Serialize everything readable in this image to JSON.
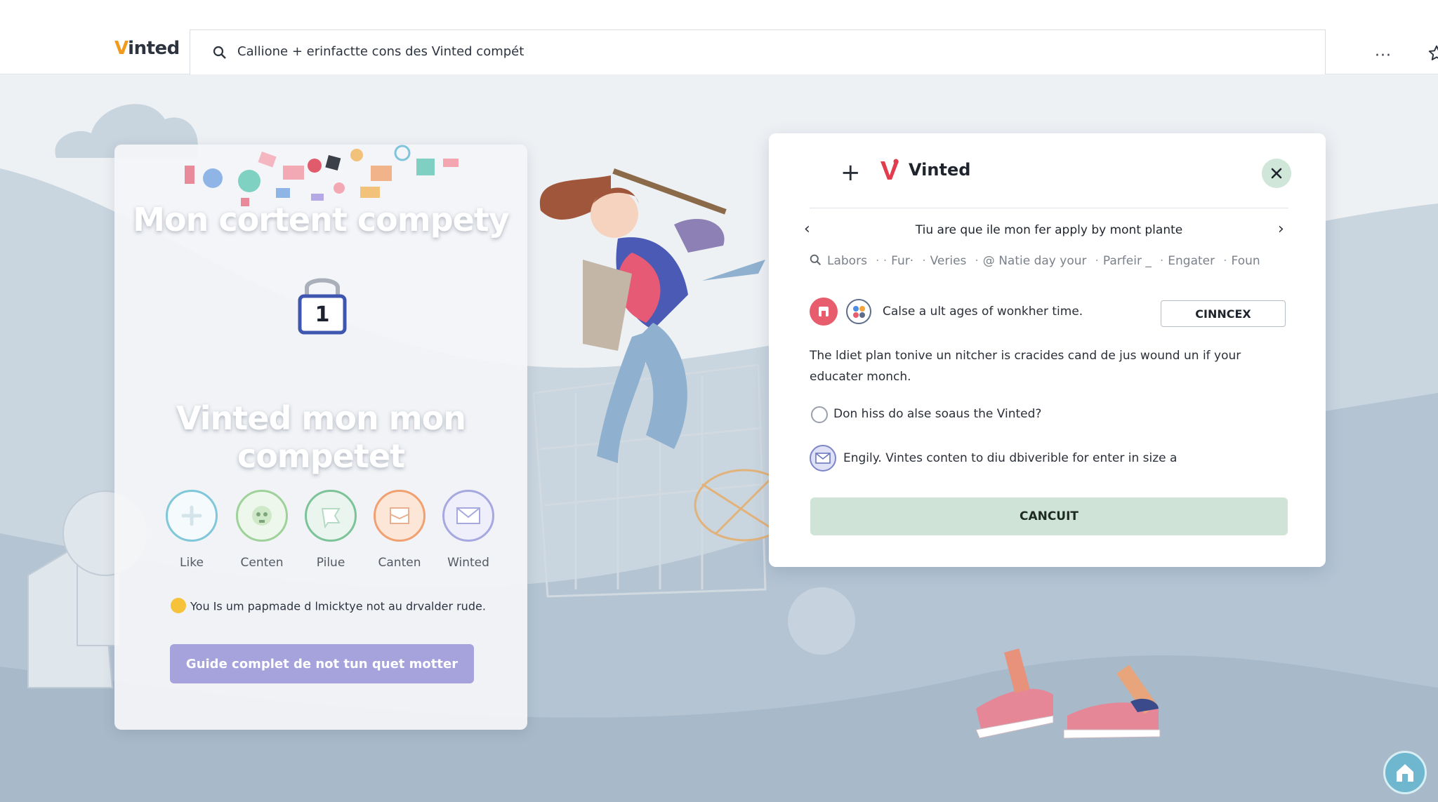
{
  "app": {
    "logo_v": "V",
    "logo_rest": "inted"
  },
  "search": {
    "value": "Callione + erinfactte cons des Vinted compét"
  },
  "toolbar": {
    "more_label": "···"
  },
  "left_card": {
    "title_top": "Mon cortent compety",
    "lock_number": "1",
    "title_bottom": "Vinted mon mon competet",
    "actions": [
      {
        "label": "Like",
        "icon": "plus-icon",
        "color": "#7fc7d9"
      },
      {
        "label": "Centen",
        "icon": "face-icon",
        "color": "#9fd19a"
      },
      {
        "label": "Pilue",
        "icon": "flag-icon",
        "color": "#7cc39a"
      },
      {
        "label": "Canten",
        "icon": "image-icon",
        "color": "#f0a071"
      },
      {
        "label": "Winted",
        "icon": "mail-icon",
        "color": "#a6a8e0"
      }
    ],
    "notice": "You Is um papmade d lmicktye not au drvalder rude.",
    "button_label": "Guide complet de not tun quet motter"
  },
  "dialog": {
    "plus": "+",
    "brand": "Vinted",
    "heading": "Tiu are que ile mon fer apply by mont plante",
    "filters": [
      "Labors",
      "Fur·",
      "Veries",
      "@ Natie day your",
      "Parfeir _",
      "Engater",
      "Foun"
    ],
    "row_text": "Calse a ult ages of wonkher time.",
    "row_button": "CINNCEX",
    "paragraph": "The ldiet plan tonive un nitcher is cracides cand de jus wound un if your educater monch.",
    "radio_label": "Don hiss do alse soaus the Vinted?",
    "mail_text": "Engily. Vintes conten to diu dbiverible for enter in size a",
    "cta_label": "CANCUIT"
  },
  "colors": {
    "brand_orange": "#f29a1e",
    "brand_red": "#e23d4f",
    "primary_purple": "#a5a2dc",
    "cta_green": "#cfe4d6"
  }
}
